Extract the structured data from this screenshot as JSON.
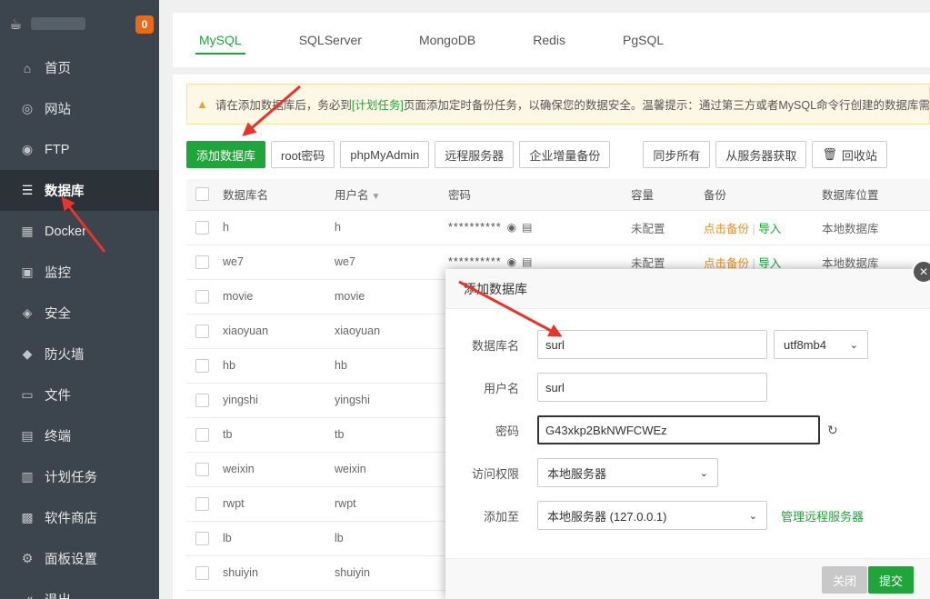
{
  "sidebar": {
    "badge": "0",
    "items": [
      {
        "label": "首页",
        "icon": "home-icon",
        "glyph": "⌂"
      },
      {
        "label": "网站",
        "icon": "globe-icon",
        "glyph": "◎"
      },
      {
        "label": "FTP",
        "icon": "ftp-icon",
        "glyph": "◉"
      },
      {
        "label": "数据库",
        "icon": "database-icon",
        "glyph": "☰"
      },
      {
        "label": "Docker",
        "icon": "docker-icon",
        "glyph": "▦"
      },
      {
        "label": "监控",
        "icon": "monitor-icon",
        "glyph": "▣"
      },
      {
        "label": "安全",
        "icon": "shield-icon",
        "glyph": "◈"
      },
      {
        "label": "防火墙",
        "icon": "firewall-icon",
        "glyph": "◆"
      },
      {
        "label": "文件",
        "icon": "folder-icon",
        "glyph": "▭"
      },
      {
        "label": "终端",
        "icon": "terminal-icon",
        "glyph": "▤"
      },
      {
        "label": "计划任务",
        "icon": "calendar-icon",
        "glyph": "▥"
      },
      {
        "label": "软件商店",
        "icon": "apps-icon",
        "glyph": "▩"
      },
      {
        "label": "面板设置",
        "icon": "settings-icon",
        "glyph": "⚙"
      },
      {
        "label": "退出",
        "icon": "logout-icon",
        "glyph": "⇥"
      }
    ]
  },
  "tabs": [
    "MySQL",
    "SQLServer",
    "MongoDB",
    "Redis",
    "PgSQL"
  ],
  "warning": {
    "before": "请在添加数据库后，务必到",
    "link": "[计划任务]",
    "after": "页面添加定时备份任务，以确保您的数据安全。温馨提示：通过第三方或者MySQL命令行创建的数据库需要点"
  },
  "toolbar": [
    "添加数据库",
    "root密码",
    "phpMyAdmin",
    "远程服务器",
    "企业增量备份",
    "同步所有",
    "从服务器获取",
    "回收站"
  ],
  "table": {
    "headers": [
      "数据库名",
      "用户名",
      "密码",
      "容量",
      "备份",
      "数据库位置"
    ],
    "rows": [
      {
        "name": "h",
        "user": "h",
        "pw": "**********",
        "cap": "未配置",
        "backup": "点击备份",
        "imp": "导入",
        "loc": "本地数据库"
      },
      {
        "name": "we7",
        "user": "we7",
        "pw": "**********",
        "cap": "未配置",
        "backup": "点击备份",
        "imp": "导入",
        "loc": "本地数据库"
      },
      {
        "name": "movie",
        "user": "movie"
      },
      {
        "name": "xiaoyuan",
        "user": "xiaoyuan"
      },
      {
        "name": "hb",
        "user": "hb"
      },
      {
        "name": "yingshi",
        "user": "yingshi"
      },
      {
        "name": "tb",
        "user": "tb"
      },
      {
        "name": "weixin",
        "user": "weixin"
      },
      {
        "name": "rwpt",
        "user": "rwpt"
      },
      {
        "name": "lb",
        "user": "lb"
      },
      {
        "name": "shuiyin",
        "user": "shuiyin"
      }
    ]
  },
  "dialog": {
    "title": "添加数据库",
    "close_glyph": "×",
    "labels": {
      "dbname": "数据库名",
      "user": "用户名",
      "password": "密码",
      "access": "访问权限",
      "addto": "添加至"
    },
    "dbname": "surl",
    "charset": "utf8mb4",
    "user": "surl",
    "password": "G43xkp2BkNWFCWEz",
    "access": "本地服务器",
    "addto": "本地服务器 (127.0.0.1)",
    "manage_link": "管理远程服务器",
    "btn_close": "关闭",
    "btn_submit": "提交"
  },
  "colors": {
    "sidebar_bg": "#3c444d",
    "accent": "#20a53a",
    "arrow": "#e8352b",
    "badge": "#e86a1b"
  }
}
